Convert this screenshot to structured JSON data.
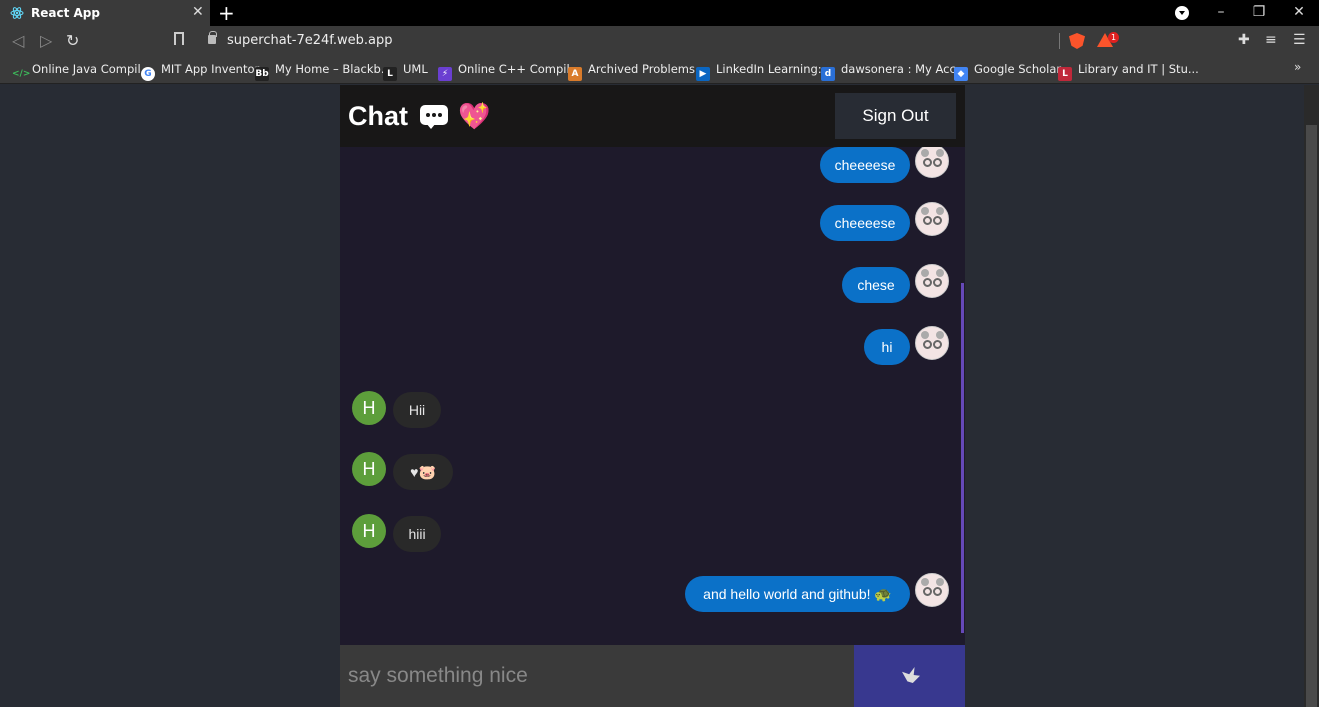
{
  "browser": {
    "tab_title": "React App",
    "url": "superchat-7e24f.web.app",
    "bookmarks": [
      {
        "label": "Online Java Compil...",
        "icon": "code-icon",
        "color": "#3dbb5b"
      },
      {
        "label": "MIT App Inventor",
        "icon": "google-icon",
        "color": "#ffffff"
      },
      {
        "label": "My Home – Blackb...",
        "icon": "blackboard-icon",
        "color": "#222222"
      },
      {
        "label": "UML",
        "icon": "uml-icon",
        "color": "#222222"
      },
      {
        "label": "Online C++ Compil...",
        "icon": "lightning-icon",
        "color": "#6a3fd1"
      },
      {
        "label": "Archived Problems...",
        "icon": "archive-icon",
        "color": "#d97b2b"
      },
      {
        "label": "LinkedIn Learning:...",
        "icon": "play-icon",
        "color": "#0a66c2"
      },
      {
        "label": "dawsonera : My Acc...",
        "icon": "book-icon",
        "color": "#2a6fd6"
      },
      {
        "label": "Google Scholar",
        "icon": "scholar-icon",
        "color": "#4285f4"
      },
      {
        "label": "Library and IT | Stu...",
        "icon": "library-icon",
        "color": "#c0283a"
      }
    ],
    "alert_count": "1"
  },
  "app": {
    "title": "Chat",
    "signout_label": "Sign Out",
    "input_placeholder": "say something nice",
    "accent": "#0b71c8",
    "send_color": "#38388f"
  },
  "messages": [
    {
      "side": "sent",
      "text": "cheeeese"
    },
    {
      "side": "sent",
      "text": "cheeeese"
    },
    {
      "side": "sent",
      "text": "chese"
    },
    {
      "side": "sent",
      "text": "hi"
    },
    {
      "side": "recv",
      "avatar": "H",
      "text": "Hii"
    },
    {
      "side": "recv",
      "avatar": "H",
      "text": "♥🐷"
    },
    {
      "side": "recv",
      "avatar": "H",
      "text": "hiii"
    },
    {
      "side": "sent",
      "text": "and hello world and github! 🐢"
    }
  ]
}
